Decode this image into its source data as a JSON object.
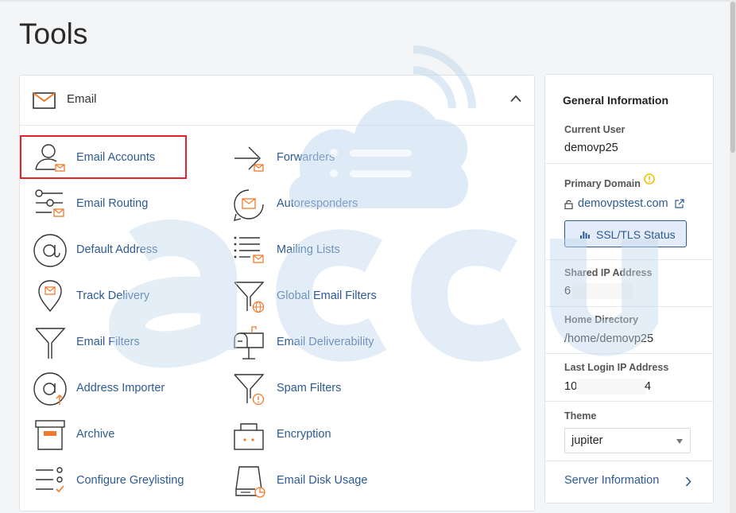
{
  "page": {
    "title": "Tools"
  },
  "email_panel": {
    "title": "Email",
    "tools": [
      {
        "label": "Email Accounts",
        "icon": "user-mail-icon"
      },
      {
        "label": "Forwarders",
        "icon": "forward-arrow-icon"
      },
      {
        "label": "Email Routing",
        "icon": "routing-icon"
      },
      {
        "label": "Autoresponders",
        "icon": "autoresponder-icon"
      },
      {
        "label": "Default Address",
        "icon": "at-sign-icon"
      },
      {
        "label": "Mailing Lists",
        "icon": "list-mail-icon"
      },
      {
        "label": "Track Delivery",
        "icon": "location-pin-icon"
      },
      {
        "label": "Global Email Filters",
        "icon": "filter-globe-icon"
      },
      {
        "label": "Email Filters",
        "icon": "filter-icon"
      },
      {
        "label": "Email Deliverability",
        "icon": "mailbox-icon"
      },
      {
        "label": "Address Importer",
        "icon": "at-import-icon"
      },
      {
        "label": "Spam Filters",
        "icon": "filter-warning-icon"
      },
      {
        "label": "Archive",
        "icon": "archive-box-icon"
      },
      {
        "label": "Encryption",
        "icon": "encryption-icon"
      },
      {
        "label": "Configure Greylisting",
        "icon": "checklist-icon"
      },
      {
        "label": "Email Disk Usage",
        "icon": "disk-usage-icon"
      }
    ]
  },
  "general_info": {
    "title": "General Information",
    "current_user_label": "Current User",
    "current_user": "demovp25",
    "primary_domain_label": "Primary Domain",
    "primary_domain": "demovpstest.com",
    "ssl_button": "SSL/TLS Status",
    "shared_ip_label": "Shared IP Address",
    "shared_ip": "6",
    "home_dir_label": "Home Directory",
    "home_dir": "/home/demovp25",
    "last_login_label": "Last Login IP Address",
    "last_login_prefix": "10",
    "last_login_suffix": "4",
    "theme_label": "Theme",
    "theme": "jupiter",
    "server_info": "Server Information"
  },
  "colors": {
    "link": "#2d5a92",
    "highlight": "#e8222d",
    "warning": "#f2c200",
    "watermark": "#c3d9ee"
  }
}
